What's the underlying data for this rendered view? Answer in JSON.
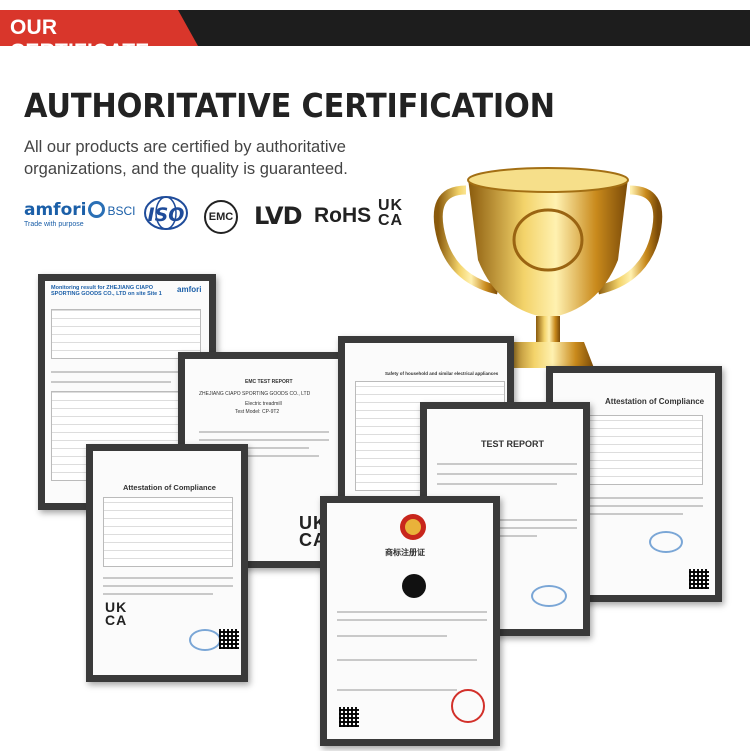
{
  "banner": {
    "title": "OUR CERTIFICATE"
  },
  "headline": "AUTHORITATIVE CERTIFICATION",
  "subtitle": "All our products are certified by authoritative organizations, and the quality is guaranteed.",
  "logos": {
    "amfori": "amfori",
    "bsci": "BSCI",
    "amfori_tag": "Trade with purpose",
    "iso": "ISO",
    "emc": "EMC",
    "lvd": "LVD",
    "rohs": "RoHS",
    "ukca_top": "UK",
    "ukca_bottom": "CA"
  },
  "certs": {
    "amfori_report": {
      "title": "Monitoring result for ZHEJIANG CIAPO SPORTING GOODS CO., LTD on site Site 1",
      "brand": "amfori"
    },
    "emc_report": {
      "title": "EMC TEST REPORT",
      "company": "ZHEJIANG CIAPO SPORTING GOODS CO., LTD",
      "product": "Electric treadmill",
      "model": "Test Model: CP-9T2"
    },
    "lvd_report": {
      "title": "Safety of household and similar electrical appliances"
    },
    "attestation_right": {
      "title": "Attestation of Compliance"
    },
    "test_report": {
      "title": "TEST REPORT"
    },
    "attestation_left": {
      "title": "Attestation of Compliance",
      "ukca_top": "UK",
      "ukca_bottom": "CA"
    },
    "trademark": {
      "title": "商标注册证"
    },
    "emc_ukca": {
      "ukca_top": "UK",
      "ukca_bottom": "CA"
    }
  },
  "colors": {
    "banner_red": "#d9362b",
    "banner_dark": "#1d1d1d",
    "frame": "#3a3a3a",
    "gold": "#d9a521"
  }
}
